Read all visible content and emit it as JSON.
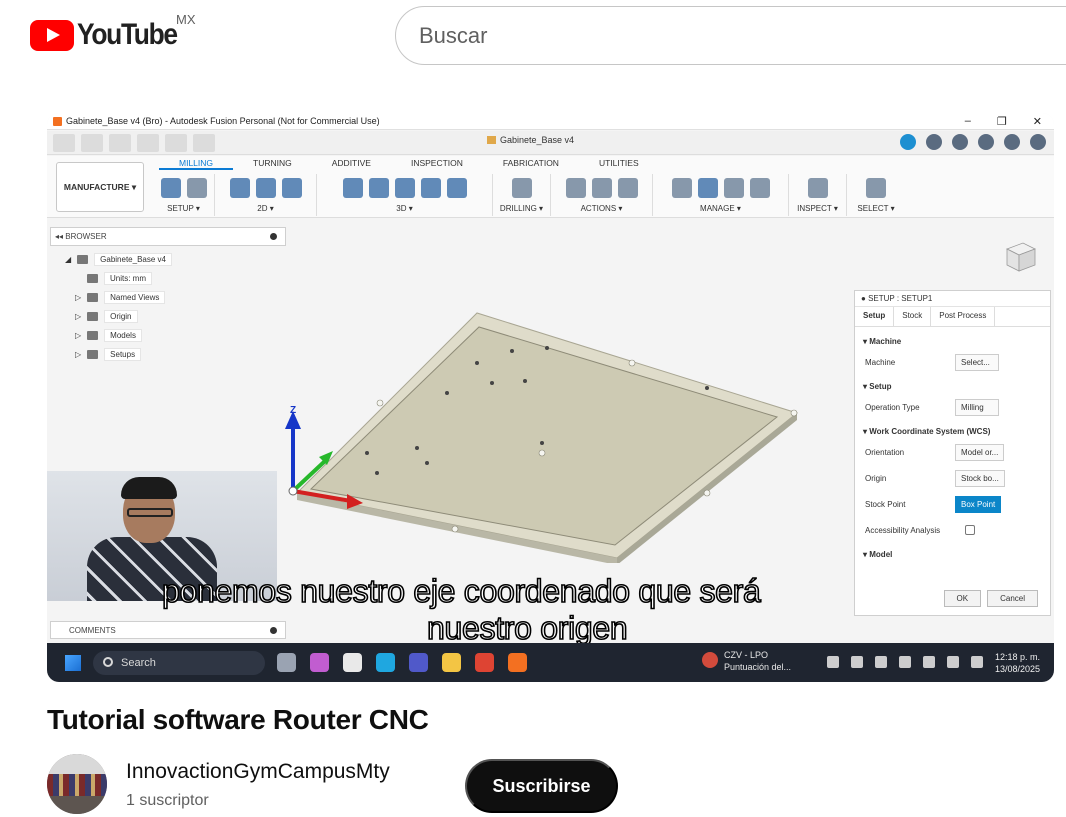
{
  "header": {
    "logo_text": "YouTube",
    "country_code": "MX",
    "search_placeholder": "Buscar"
  },
  "fusion": {
    "window_title": "Gabinete_Base v4 (Bro) - Autodesk Fusion Personal (Not for Commercial Use)",
    "doc_tab": "Gabinete_Base v4",
    "workspace": "MANUFACTURE",
    "ribbon_tabs": [
      "MILLING",
      "TURNING",
      "ADDITIVE",
      "INSPECTION",
      "FABRICATION",
      "UTILITIES"
    ],
    "active_tab": "MILLING",
    "groups": [
      "SETUP ▾",
      "2D ▾",
      "3D ▾",
      "DRILLING ▾",
      "ACTIONS ▾",
      "MANAGE ▾",
      "INSPECT ▾",
      "SELECT ▾"
    ],
    "browser": {
      "title": "BROWSER",
      "items": [
        "Gabinete_Base v4",
        "Units: mm",
        "Named Views",
        "Origin",
        "Models",
        "Setups"
      ]
    },
    "comments_label": "COMMENTS",
    "axis_label": "Z",
    "setup_panel": {
      "title": "SETUP : SETUP1",
      "tabs": [
        "Setup",
        "Stock",
        "Post Process"
      ],
      "machine_section": "Machine",
      "machine_label": "Machine",
      "machine_value": "Select...",
      "setup_section": "Setup",
      "operation_type_label": "Operation Type",
      "operation_type_value": "Milling",
      "wcs_section": "Work Coordinate System (WCS)",
      "orientation_label": "Orientation",
      "orientation_value": "Model or...",
      "origin_label": "Origin",
      "origin_value": "Stock bo...",
      "stock_point_label": "Stock Point",
      "stock_point_value": "Box Point",
      "accessibility_label": "Accessibility Analysis",
      "model_section": "Model",
      "ok": "OK",
      "cancel": "Cancel"
    }
  },
  "captions": {
    "line1": "ponemos nuestro eje coordenado que será",
    "line2": "nuestro origen"
  },
  "taskbar": {
    "search": "Search",
    "weather_title": "CZV - LPO",
    "weather_sub": "Puntuación del...",
    "time": "12:18 p. m.",
    "date": "13/08/2025"
  },
  "video": {
    "title": "Tutorial software Router CNC"
  },
  "channel": {
    "name": "InnovactionGymCampusMty",
    "subscribers": "1 suscriptor",
    "subscribe_label": "Suscribirse"
  }
}
